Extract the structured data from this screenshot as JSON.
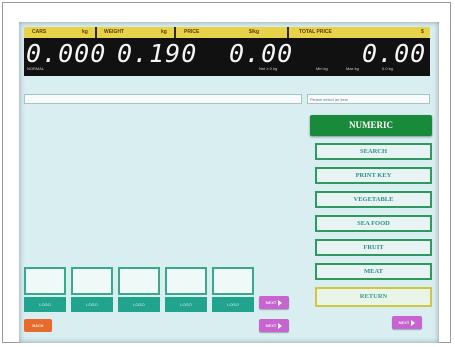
{
  "header": {
    "cars_label": "CARS",
    "cars_unit": "kg",
    "weight_label": "WEIGHT",
    "weight_unit": "kg",
    "price_label": "PRICE",
    "price_unit": "$/kg",
    "total_label": "TOTAL PRICE",
    "total_unit": "$"
  },
  "display": {
    "cars_value": "0.000",
    "weight_value": "0.190",
    "price_value": "0.00",
    "total_value": "0.00",
    "left_small_label": "NORMAL",
    "status_labels": [
      "Net ≥ 0 kg",
      "Min kg",
      "Max kg",
      "0.0 kg"
    ]
  },
  "search": {
    "text_value": "",
    "hint": "Please select an item"
  },
  "right_buttons": {
    "numeric": "NUMERIC",
    "categories": [
      "SEARCH",
      "PRINT KEY",
      "VEGETABLE",
      "SEA FOOD",
      "FRUIT",
      "MEAT"
    ],
    "return": "RETURN"
  },
  "plu_slots": [
    "LOGO",
    "LOGO",
    "LOGO",
    "LOGO",
    "LOGO"
  ],
  "pink_buttons": [
    "NEXT",
    "NEXT",
    "NEXT"
  ],
  "bottom_left": "BACK",
  "colors": {
    "screen_bg": "#d8eef1",
    "accent_green": "#198a3a",
    "header_yellow": "#e7d24a",
    "pink": "#c764cf",
    "orange": "#e96b2c"
  }
}
